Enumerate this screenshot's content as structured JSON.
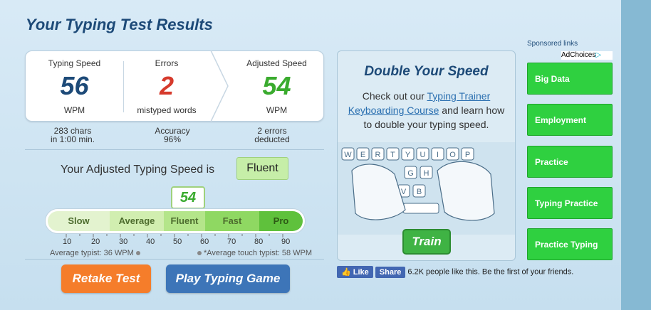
{
  "title": "Your Typing Test Results",
  "results": {
    "speed": {
      "label": "Typing Speed",
      "value": "56",
      "unit": "WPM"
    },
    "errors": {
      "label": "Errors",
      "value": "2",
      "unit": "mistyped words"
    },
    "adjusted": {
      "label": "Adjusted Speed",
      "value": "54",
      "unit": "WPM"
    }
  },
  "subrow": {
    "chars_line1": "283 chars",
    "chars_line2": "in 1:00 min.",
    "accuracy_label": "Accuracy",
    "accuracy_value": "96%",
    "errors_line1": "2 errors",
    "errors_line2": "deducted"
  },
  "adjusted_text": "Your Adjusted Typing Speed is",
  "level_badge": "Fluent",
  "meter": {
    "marker_value": "54",
    "segments": [
      "Slow",
      "Average",
      "Fluent",
      "Fast",
      "Pro"
    ],
    "ticks": [
      "10",
      "20",
      "30",
      "40",
      "50",
      "60",
      "70",
      "80",
      "90"
    ],
    "average_typist": "Average typist: 36 WPM",
    "average_touch": "*Average touch typist: 58 WPM"
  },
  "buttons": {
    "retake": "Retake Test",
    "game": "Play Typing Game"
  },
  "promo": {
    "title": "Double Your Speed",
    "text_before": "Check out our ",
    "link1": "Typing Trainer",
    "link2": "Keyboarding Course",
    "text_after": " and learn how to double your typing speed.",
    "train": "Train",
    "keys_row1": [
      "W",
      "E",
      "R",
      "T",
      "Y",
      "U",
      "I",
      "O",
      "P"
    ],
    "keys_row2": [
      "G",
      "H"
    ],
    "keys_row3": [
      "V",
      "B"
    ]
  },
  "facebook": {
    "like": "Like",
    "share": "Share",
    "text": "6.2K people like this. Be the first of your friends."
  },
  "sponsored": {
    "label": "Sponsored links",
    "adchoices": "AdChoices",
    "items": [
      "Big Data",
      "Employment",
      "Practice",
      "Typing Practice",
      "Practice Typing"
    ]
  },
  "colors": {
    "title": "#1d4a78",
    "speed": "#1d4a78",
    "errors": "#d63a2c",
    "adjusted": "#3aab2e",
    "retake": "#f57d2a",
    "game": "#3d75b8",
    "ad_green": "#2fd040"
  }
}
